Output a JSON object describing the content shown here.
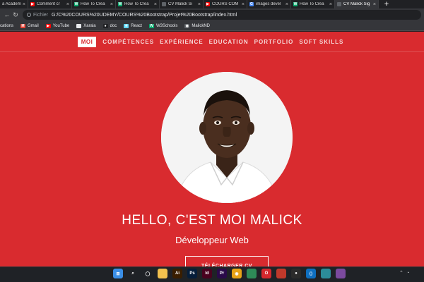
{
  "browser": {
    "tabs": [
      {
        "label": "a Academ",
        "fav_color": "#f4b400",
        "fav_glyph": ""
      },
      {
        "label": "Comment cr",
        "fav_color": "#ff0000",
        "fav_glyph": "▶"
      },
      {
        "label": "How To Crea",
        "fav_color": "#04aa6d",
        "fav_glyph": "W"
      },
      {
        "label": "How To Crea",
        "fav_color": "#04aa6d",
        "fav_glyph": "W"
      },
      {
        "label": "CV Malick Si",
        "fav_color": "#5f6368",
        "fav_glyph": ""
      },
      {
        "label": "COURS COM",
        "fav_color": "#ff0000",
        "fav_glyph": "▶"
      },
      {
        "label": "images devel",
        "fav_color": "#4285f4",
        "fav_glyph": "G"
      },
      {
        "label": "How To Crea",
        "fav_color": "#04aa6d",
        "fav_glyph": "W"
      },
      {
        "label": "CV Malick Sig",
        "fav_color": "#5f6368",
        "fav_glyph": ""
      }
    ],
    "address": {
      "scheme_label": "Fichier",
      "url": "G:/C%20COURS%20UDEMY/COURS%20Bootstrap/Projet%20Bootstrap/index.html"
    },
    "bookmarks": [
      {
        "label": "cations",
        "color": "#4285f4",
        "glyph": ""
      },
      {
        "label": "Gmail",
        "color": "#ea4335",
        "glyph": "M"
      },
      {
        "label": "YouTube",
        "color": "#ff0000",
        "glyph": "▶"
      },
      {
        "label": "Xarala",
        "color": "#e8eaed",
        "glyph": ""
      },
      {
        "label": "doc",
        "color": "#202124",
        "glyph": "●"
      },
      {
        "label": "React",
        "color": "#61dafb",
        "glyph": "⚛"
      },
      {
        "label": "W3Schools",
        "color": "#04aa6d",
        "glyph": "W"
      },
      {
        "label": "MalickND",
        "color": "#5f6368",
        "glyph": "◉"
      }
    ]
  },
  "site": {
    "brand": "MOI",
    "nav": [
      "COMPÉTENCES",
      "EXPÉRIENCE",
      "EDUCATION",
      "PORTFOLIO",
      "SOFT SKILLS"
    ],
    "hero_title": "HELLO, C'EST MOI MALICK",
    "hero_subtitle": "Développeur Web",
    "cv_button": "TÉLÉCHARGER CV"
  },
  "colors": {
    "primary": "#d92b2f",
    "browser_bg": "#202124",
    "toolbar_bg": "#35363a"
  },
  "taskbar": {
    "icons": [
      {
        "name": "windows-start-icon",
        "color": "#3a8ee6",
        "glyph": "⊞"
      },
      {
        "name": "search-icon",
        "color": "#1f2226",
        "glyph": "⌕"
      },
      {
        "name": "cortana-icon",
        "color": "#1f2226",
        "glyph": "◯"
      },
      {
        "name": "file-explorer-icon",
        "color": "#f2c14e",
        "glyph": ""
      },
      {
        "name": "illustrator-icon",
        "color": "#3a1e00",
        "glyph": "Ai"
      },
      {
        "name": "photoshop-icon",
        "color": "#061e3a",
        "glyph": "Ps"
      },
      {
        "name": "indesign-icon",
        "color": "#49021f",
        "glyph": "Id"
      },
      {
        "name": "premiere-icon",
        "color": "#2a0a4a",
        "glyph": "Pr"
      },
      {
        "name": "chrome-icon",
        "color": "#e8a317",
        "glyph": "◉"
      },
      {
        "name": "app-green-icon",
        "color": "#2e8b57",
        "glyph": ""
      },
      {
        "name": "opera-icon",
        "color": "#d6282e",
        "glyph": "O"
      },
      {
        "name": "app-red-icon",
        "color": "#c0392b",
        "glyph": ""
      },
      {
        "name": "obs-icon",
        "color": "#2b2b2b",
        "glyph": "●"
      },
      {
        "name": "vscode-icon",
        "color": "#0e6fc0",
        "glyph": "⟨⟩"
      },
      {
        "name": "app-teal-icon",
        "color": "#2c8c99",
        "glyph": ""
      },
      {
        "name": "app-photo-icon",
        "color": "#7b4a9e",
        "glyph": ""
      }
    ]
  }
}
